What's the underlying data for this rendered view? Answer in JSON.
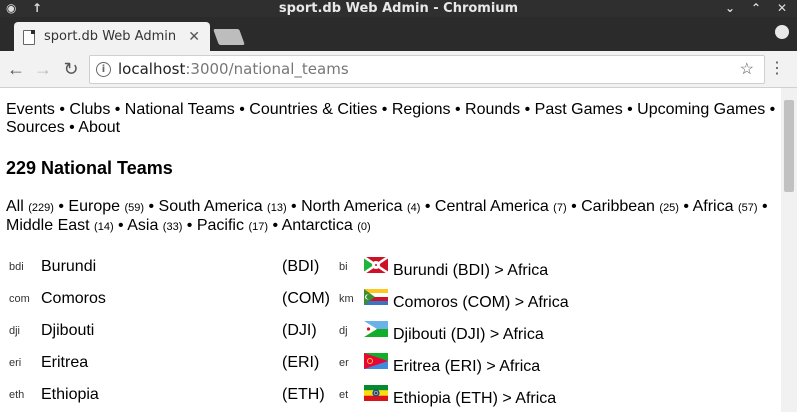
{
  "window": {
    "title": "sport.db Web Admin - Chromium"
  },
  "tab": {
    "label": "sport.db Web Admin"
  },
  "address": {
    "host": "localhost",
    "path": ":3000/national_teams"
  },
  "nav": {
    "text": "Events • Clubs • National Teams • Countries & Cities • Regions • Rounds • Past Games • Upcoming Games • Sources • About"
  },
  "heading": "229 National Teams",
  "regions": [
    {
      "name": "All",
      "count": "(229)"
    },
    {
      "name": "Europe",
      "count": "(59)"
    },
    {
      "name": "South America",
      "count": "(13)"
    },
    {
      "name": "North America",
      "count": "(4)"
    },
    {
      "name": "Central America",
      "count": "(7)"
    },
    {
      "name": "Caribbean",
      "count": "(25)"
    },
    {
      "name": "Africa",
      "count": "(57)"
    },
    {
      "name": "Middle East",
      "count": "(14)"
    },
    {
      "name": "Asia",
      "count": "(33)"
    },
    {
      "name": "Pacific",
      "count": "(17)"
    },
    {
      "name": "Antarctica",
      "count": "(0)"
    }
  ],
  "teams": [
    {
      "code": "bdi",
      "name": "Burundi",
      "abbr": "(BDI)",
      "iso2": "bi",
      "desc": "Burundi (BDI) > Africa",
      "flag": "burundi"
    },
    {
      "code": "com",
      "name": "Comoros",
      "abbr": "(COM)",
      "iso2": "km",
      "desc": "Comoros (COM) > Africa",
      "flag": "comoros"
    },
    {
      "code": "dji",
      "name": "Djibouti",
      "abbr": "(DJI)",
      "iso2": "dj",
      "desc": "Djibouti (DJI) > Africa",
      "flag": "djibouti"
    },
    {
      "code": "eri",
      "name": "Eritrea",
      "abbr": "(ERI)",
      "iso2": "er",
      "desc": "Eritrea (ERI) > Africa",
      "flag": "eritrea"
    },
    {
      "code": "eth",
      "name": "Ethiopia",
      "abbr": "(ETH)",
      "iso2": "et",
      "desc": "Ethiopia (ETH) > Africa",
      "flag": "ethiopia"
    }
  ]
}
